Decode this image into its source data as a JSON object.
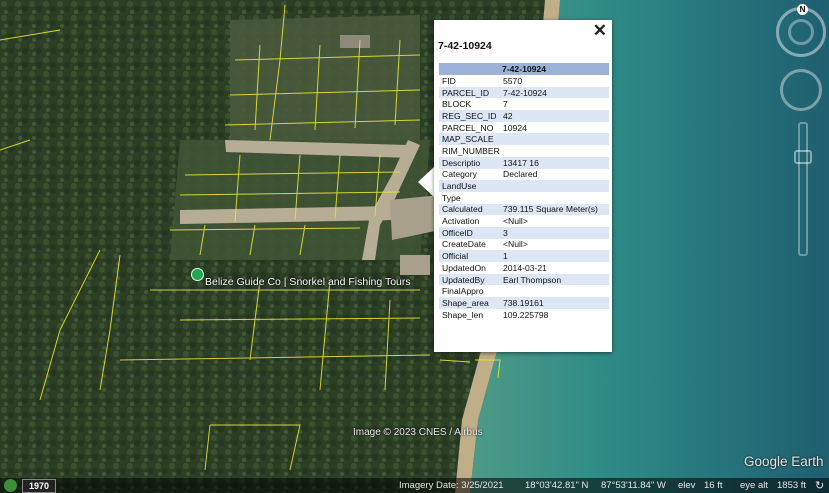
{
  "popup": {
    "title": "7-42-10924",
    "table_header": "7-42-10924",
    "close_glyph": "✕",
    "rows": [
      {
        "key": "FID",
        "value": "5570"
      },
      {
        "key": "PARCEL_ID",
        "value": "7-42-10924"
      },
      {
        "key": "BLOCK",
        "value": "7"
      },
      {
        "key": "REG_SEC_ID",
        "value": "42"
      },
      {
        "key": "PARCEL_NO",
        "value": "10924"
      },
      {
        "key": "MAP_SCALE",
        "value": ""
      },
      {
        "key": "RIM_NUMBER",
        "value": ""
      },
      {
        "key": "Descriptio",
        "value": "13417 16"
      },
      {
        "key": "Category",
        "value": "Declared"
      },
      {
        "key": "LandUse",
        "value": ""
      },
      {
        "key": "Type",
        "value": ""
      },
      {
        "key": "Calculated",
        "value": "739.115 Square Meter(s)"
      },
      {
        "key": "Activation",
        "value": "<Null>"
      },
      {
        "key": "OfficeID",
        "value": "3"
      },
      {
        "key": "CreateDate",
        "value": "<Null>"
      },
      {
        "key": "Official",
        "value": "1"
      },
      {
        "key": "UpdatedOn",
        "value": "2014-03-21"
      },
      {
        "key": "UpdatedBy",
        "value": "Earl Thompson"
      },
      {
        "key": "FinalAppro",
        "value": ""
      },
      {
        "key": "Shape_area",
        "value": "738.19161"
      },
      {
        "key": "Shape_len",
        "value": "109.225798"
      }
    ]
  },
  "map": {
    "place_label": "Belize Guide Co | Snorkel and Fishing Tours",
    "attribution": "Image © 2023 CNES / Airbus",
    "logo": "Google Earth"
  },
  "status": {
    "year": "1970",
    "imagery_date": "Imagery Date: 3/25/2021",
    "lat": "18°03'42.81\" N",
    "lon": "87°53'11.84\" W",
    "elev_label": "elev",
    "elev_value": "16 ft",
    "eye_label": "eye alt",
    "eye_value": "1853 ft"
  },
  "nav": {
    "north": "N"
  },
  "colors": {
    "parcel_lines": "#e8e23a",
    "table_header": "#9cb2d8",
    "row_alt": "#dde6f4",
    "sea": "#2e8a83"
  }
}
